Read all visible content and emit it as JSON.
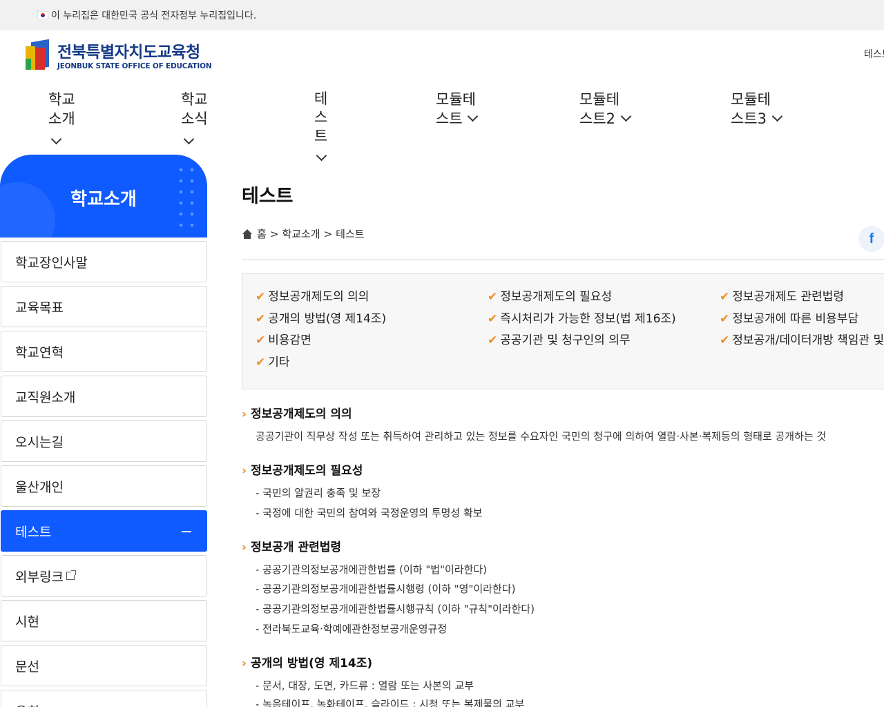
{
  "gov_banner": {
    "text": "이 누리집은 대한민국 공식 전자정부 누리집입니다."
  },
  "logo": {
    "ko": "전북특별자치도교육청",
    "en": "JEONBUK STATE OFFICE OF EDUCATION"
  },
  "header_right": {
    "text": "테스트"
  },
  "gnb": [
    {
      "line1": "학교",
      "line2": "소개"
    },
    {
      "line1": "학교",
      "line2": "소식"
    },
    {
      "line1": "테",
      "line2": "스",
      "line3": "트"
    },
    {
      "line1": "모듈테",
      "line2": "스트"
    },
    {
      "line1": "모듈테",
      "line2": "스트2"
    },
    {
      "line1": "모듈테",
      "line2": "스트3"
    }
  ],
  "sidebar": {
    "title": "학교소개",
    "items": [
      {
        "label": "학교장인사말"
      },
      {
        "label": "교육목표"
      },
      {
        "label": "학교연혁"
      },
      {
        "label": "교직원소개"
      },
      {
        "label": "오시는길"
      },
      {
        "label": "울산개인"
      },
      {
        "label": "테스트"
      },
      {
        "label": "외부링크"
      },
      {
        "label": "시현"
      },
      {
        "label": "문선"
      },
      {
        "label": "유희"
      }
    ]
  },
  "page": {
    "title": "테스트",
    "breadcrumb": [
      "홈",
      "학교소개",
      "테스트"
    ],
    "breadcrumb_sep": ">",
    "facebook_icon": "f"
  },
  "toc": {
    "check_icon": "✔",
    "col1": [
      "정보공개제도의 의의",
      "공개의 방법(영 제14조)",
      "비용감면",
      "기타"
    ],
    "col2": [
      "정보공개제도의 필요성",
      "즉시처리가 가능한 정보(법 제16조)",
      "공공기관 및 청구인의 의무"
    ],
    "col3": [
      "정보공개제도 관련법령",
      "정보공개에 따른 비용부담",
      "정보공개/데이터개방 책임관 및"
    ]
  },
  "sections": [
    {
      "title": "정보공개제도의 의의",
      "lines": [
        "공공기관이 직무상 작성 또는 취득하여 관리하고 있는 정보를 수요자인 국민의 청구에 의하여 열람·사본·복제등의 형태로 공개하는 것"
      ]
    },
    {
      "title": "정보공개제도의 필요성",
      "lines": [
        "- 국민의 알권리 충족 및 보장",
        "- 국정에 대한 국민의 참여와 국정운영의 투명성 확보"
      ]
    },
    {
      "title": "정보공개 관련법령",
      "lines": [
        "- 공공기관의정보공개에관한법률 (이하 \"법\"이라한다)",
        "- 공공기관의정보공개에관한법률시행령 (이하 \"영\"이라한다)",
        "- 공공기관의정보공개에관한법률시행규칙 (이하 \"규칙\"이라한다)",
        "- 전라북도교육·학예에관한정보공개운영규정"
      ]
    },
    {
      "title": "공개의 방법(영 제14조)",
      "lines": [
        "- 문서, 대장, 도면, 카드류 : 열람 또는 사본의 교부",
        "- 녹음테이프, 녹화테이프, 슬라이드 : 시청 또는 복제물의 교부"
      ]
    }
  ],
  "section_arrow": "›",
  "colors": {
    "primary": "#0f5bff",
    "accent": "#f08a24",
    "logo_navy": "#153b86"
  }
}
